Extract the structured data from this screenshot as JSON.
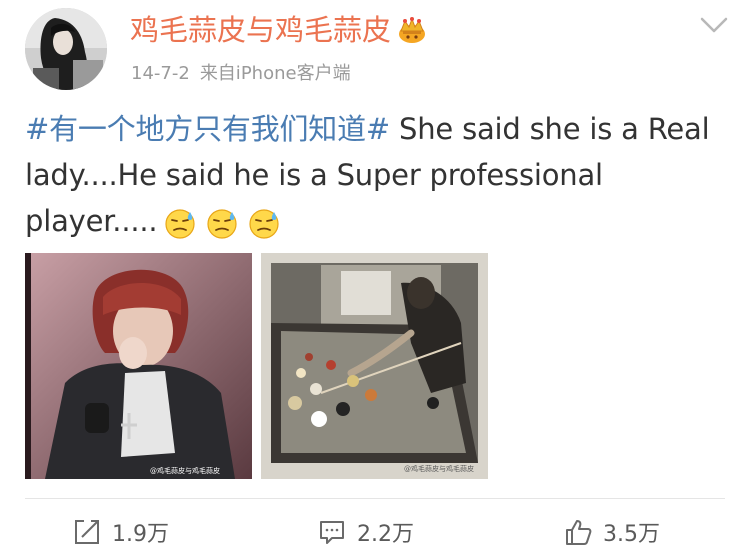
{
  "post": {
    "author": "鸡毛蒜皮与鸡毛蒜皮",
    "date": "14-7-2",
    "source": "来自iPhone客户端",
    "hashtag": "#有一个地方只有我们知道#",
    "text": " She said she is a Real lady....He said he is a Super professional player.....",
    "emojis": [
      "sweat-icon",
      "sweat-icon",
      "sweat-icon"
    ],
    "photos": [
      {
        "watermark": "@鸡毛蒜皮与鸡毛蒜皮"
      },
      {
        "watermark": "@鸡毛蒜皮与鸡毛蒜皮"
      }
    ]
  },
  "actions": {
    "repost_count": "1.9万",
    "comment_count": "2.2万",
    "like_count": "3.5万"
  },
  "colors": {
    "author": "#eb7350",
    "hashtag": "#4a7cb2",
    "text": "#333333",
    "meta": "#9a9a9a"
  }
}
